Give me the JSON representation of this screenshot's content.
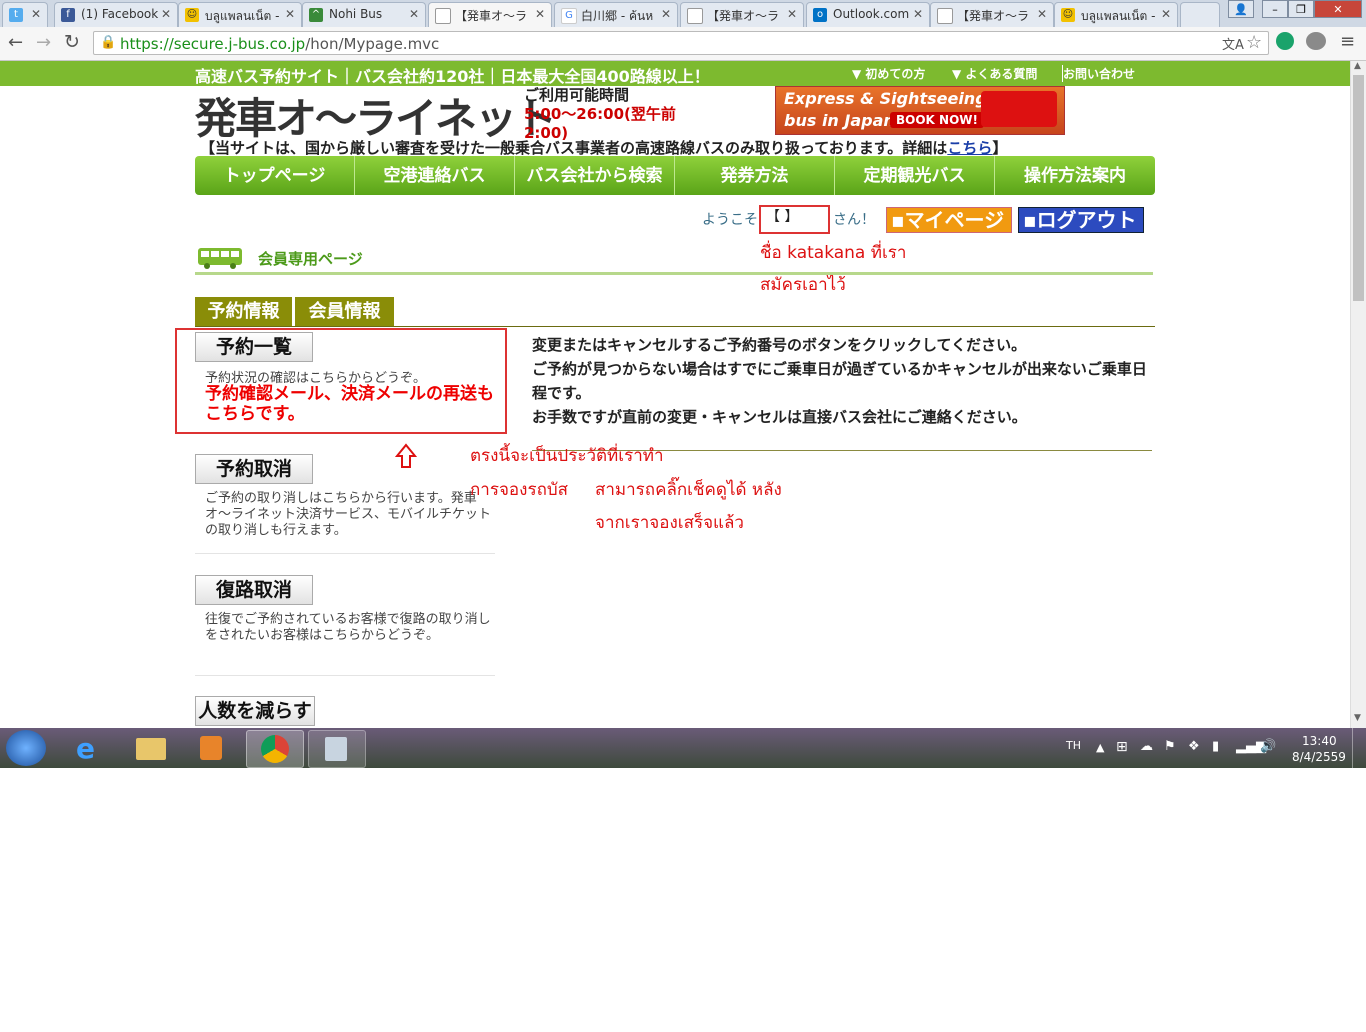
{
  "browser": {
    "tabs": [
      {
        "title": "",
        "icon": "twitter-icon"
      },
      {
        "title": "(1) Facebook",
        "icon": "facebook-icon"
      },
      {
        "title": "บลูแพลนเน็ต -",
        "icon": "smiley-icon"
      },
      {
        "title": "Nohi Bus",
        "icon": "bus-logo-icon"
      },
      {
        "title": "【発車オ〜ラ",
        "icon": "page-icon"
      },
      {
        "title": "白川郷 - ค้นห",
        "icon": "google-icon"
      },
      {
        "title": "【発車オ〜ラ",
        "icon": "page-icon"
      },
      {
        "title": "Outlook.com",
        "icon": "outlook-icon"
      },
      {
        "title": "【発車オ〜ラ",
        "icon": "page-icon"
      },
      {
        "title": "บลูแพลนเน็ต -",
        "icon": "smiley-icon"
      }
    ],
    "url_host": "https://secure.j-bus.co.jp",
    "url_path": "/hon/Mypage.mvc"
  },
  "site": {
    "slogan": "高速バス予約サイト｜バス会社約120社｜日本最大全国400路線以上！",
    "top_links": [
      "初めての方",
      "よくある質問",
      "お問い合わせ"
    ],
    "logo": "発車オ〜ライネット",
    "hours_label": "ご利用可能時間",
    "hours_value": "5:00〜26:00(翌午前2:00)",
    "banner_line1": "Express & Sightseeing",
    "banner_line2": "bus in Japan",
    "banner_button": "BOOK NOW!",
    "notice_text": "【当サイトは、国から厳しい審査を受けた一般乗合バス事業者の高速路線バスのみ取り扱っております。詳細は",
    "notice_link": "こちら",
    "notice_end": "】",
    "nav": [
      "トップページ",
      "空港連絡バス",
      "バス会社から検索",
      "発券方法",
      "定期観光バス",
      "操作方法案内"
    ]
  },
  "user": {
    "welcome": "ようこそ",
    "name": "【      】",
    "san": "さん！",
    "mypage_button": "マイページ",
    "logout_button": "ログアウト"
  },
  "member": {
    "title": "会員専用ページ",
    "tabs": [
      "予約情報",
      "会員情報"
    ],
    "menu": [
      {
        "label": "予約一覧",
        "desc": "予約状況の確認はこちらからどうぞ。",
        "note": "予約確認メール、決済メールの再送もこちらです。"
      },
      {
        "label": "予約取消",
        "desc": "ご予約の取り消しはこちらから行います。発車オ〜ライネット決済サービス、モバイルチケットの取り消しも行えます。"
      },
      {
        "label": "復路取消",
        "desc": "往復でご予約されているお客様で復路の取り消しをされたいお客様はこちらからどうぞ。"
      },
      {
        "label": "人数を減らす",
        "desc": ""
      }
    ],
    "info_lines": [
      "変更またはキャンセルするご予約番号のボタンをクリックしてください。",
      "ご予約が見つからない場合はすでにご乗車日が過ぎているかキャンセルが出来ないご乗車日程です。",
      "お手数ですが直前の変更・キャンセルは直接バス会社にご連絡ください。"
    ]
  },
  "annotations": {
    "name_note_1": "ชื่อ katakana ที่เรา",
    "name_note_2": "สมัครเอาไว้",
    "history_1": "ตรงนี้จะเป็นประวัติที่เราทำ",
    "history_2": "การจองรถบัส",
    "history_3": "สามารถคลิ๊กเช็คดูได้ หลัง",
    "history_4": "จากเราจองเสร็จแล้ว"
  },
  "taskbar": {
    "lang": "TH",
    "time": "13:40",
    "date": "8/4/2559"
  },
  "colors": {
    "green_bar": "#7dba2f",
    "nav_green": "#5aa418",
    "tab_olive": "#8a8d08",
    "annotation_red": "#dd1111",
    "mypage_orange": "#f19a10",
    "logout_blue": "#2c4bbf"
  }
}
